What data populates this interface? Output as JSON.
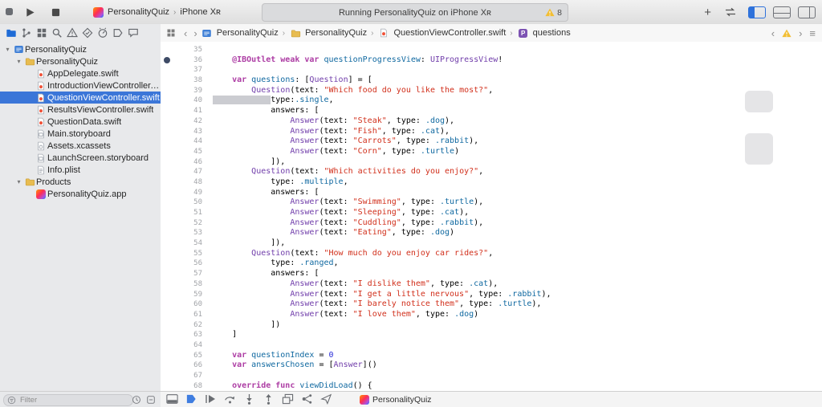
{
  "toolbar": {
    "scheme": "PersonalityQuiz",
    "device": "iPhone Xʀ",
    "status_text": "Running PersonalityQuiz on iPhone Xʀ",
    "warning_count": "8",
    "plus_label": "+"
  },
  "glyphs": {
    "back": "‹",
    "forward": "›",
    "crumb_sep": "›",
    "menu": "≡",
    "disclosure": "▾"
  },
  "navigator": {
    "tabs": [
      "project",
      "source-control",
      "symbol",
      "find",
      "issue",
      "test",
      "debug",
      "breakpoint",
      "report"
    ],
    "active": "project"
  },
  "jumpbar": {
    "crumbs": [
      {
        "label": "PersonalityQuiz",
        "icon": "project"
      },
      {
        "label": "PersonalityQuiz",
        "icon": "folder"
      },
      {
        "label": "QuestionViewController.swift",
        "icon": "swift"
      },
      {
        "label": "questions",
        "icon": "property"
      }
    ],
    "property_letter": "P"
  },
  "sidebar": {
    "items": [
      {
        "label": "PersonalityQuiz",
        "icon": "project",
        "level": 0,
        "disclosure": true
      },
      {
        "label": "PersonalityQuiz",
        "icon": "folder",
        "level": 1,
        "disclosure": true
      },
      {
        "label": "AppDelegate.swift",
        "icon": "swift",
        "level": 2
      },
      {
        "label": "IntroductionViewController.swift",
        "icon": "swift",
        "level": 2
      },
      {
        "label": "QuestionViewController.swift",
        "icon": "swift",
        "level": 2,
        "selected": true
      },
      {
        "label": "ResultsViewController.swift",
        "icon": "swift",
        "level": 2
      },
      {
        "label": "QuestionData.swift",
        "icon": "swift",
        "level": 2
      },
      {
        "label": "Main.storyboard",
        "icon": "storyboard",
        "level": 2
      },
      {
        "label": "Assets.xcassets",
        "icon": "assets",
        "level": 2
      },
      {
        "label": "LaunchScreen.storyboard",
        "icon": "storyboard",
        "level": 2
      },
      {
        "label": "Info.plist",
        "icon": "plist",
        "level": 2
      },
      {
        "label": "Products",
        "icon": "folder",
        "level": 1,
        "disclosure": true
      },
      {
        "label": "PersonalityQuiz.app",
        "icon": "app",
        "level": 2
      }
    ]
  },
  "editor": {
    "lines": [
      {
        "n": "35",
        "segs": []
      },
      {
        "n": "36",
        "well": true,
        "segs": [
          [
            "k",
            "    @IBOutlet weak var "
          ],
          [
            "d",
            "questionProgressView"
          ],
          [
            "p",
            ": "
          ],
          [
            "t",
            "UIProgressView"
          ],
          [
            "p",
            "!"
          ]
        ]
      },
      {
        "n": "37",
        "segs": []
      },
      {
        "n": "38",
        "segs": [
          [
            "k",
            "    var "
          ],
          [
            "d",
            "questions"
          ],
          [
            "p",
            ": ["
          ],
          [
            "t",
            "Question"
          ],
          [
            "p",
            "] = ["
          ]
        ]
      },
      {
        "n": "39",
        "segs": [
          [
            "p",
            "        "
          ],
          [
            "t",
            "Question"
          ],
          [
            "p",
            "(text: "
          ],
          [
            "s",
            "\"Which food do you like the most?\""
          ],
          [
            "p",
            ","
          ]
        ]
      },
      {
        "n": "40",
        "segs": [
          [
            "w",
            "            "
          ],
          [
            "p",
            "type:"
          ],
          [
            "e",
            ".single"
          ],
          [
            "p",
            ","
          ]
        ]
      },
      {
        "n": "41",
        "segs": [
          [
            "p",
            "            answers: ["
          ]
        ]
      },
      {
        "n": "42",
        "segs": [
          [
            "p",
            "                "
          ],
          [
            "t",
            "Answer"
          ],
          [
            "p",
            "(text: "
          ],
          [
            "s",
            "\"Steak\""
          ],
          [
            "p",
            ", type: "
          ],
          [
            "e",
            ".dog"
          ],
          [
            "p",
            "),"
          ]
        ]
      },
      {
        "n": "43",
        "segs": [
          [
            "p",
            "                "
          ],
          [
            "t",
            "Answer"
          ],
          [
            "p",
            "(text: "
          ],
          [
            "s",
            "\"Fish\""
          ],
          [
            "p",
            ", type: "
          ],
          [
            "e",
            ".cat"
          ],
          [
            "p",
            "),"
          ]
        ]
      },
      {
        "n": "44",
        "segs": [
          [
            "p",
            "                "
          ],
          [
            "t",
            "Answer"
          ],
          [
            "p",
            "(text: "
          ],
          [
            "s",
            "\"Carrots\""
          ],
          [
            "p",
            ", type: "
          ],
          [
            "e",
            ".rabbit"
          ],
          [
            "p",
            "),"
          ]
        ]
      },
      {
        "n": "45",
        "segs": [
          [
            "p",
            "                "
          ],
          [
            "t",
            "Answer"
          ],
          [
            "p",
            "(text: "
          ],
          [
            "s",
            "\"Corn\""
          ],
          [
            "p",
            ", type: "
          ],
          [
            "e",
            ".turtle"
          ],
          [
            "p",
            ")"
          ]
        ]
      },
      {
        "n": "46",
        "segs": [
          [
            "p",
            "            ]),"
          ]
        ]
      },
      {
        "n": "47",
        "segs": [
          [
            "p",
            "        "
          ],
          [
            "t",
            "Question"
          ],
          [
            "p",
            "(text: "
          ],
          [
            "s",
            "\"Which activities do you enjoy?\""
          ],
          [
            "p",
            ","
          ]
        ]
      },
      {
        "n": "48",
        "segs": [
          [
            "p",
            "            type: "
          ],
          [
            "e",
            ".multiple"
          ],
          [
            "p",
            ","
          ]
        ]
      },
      {
        "n": "49",
        "segs": [
          [
            "p",
            "            answers: ["
          ]
        ]
      },
      {
        "n": "50",
        "segs": [
          [
            "p",
            "                "
          ],
          [
            "t",
            "Answer"
          ],
          [
            "p",
            "(text: "
          ],
          [
            "s",
            "\"Swimming\""
          ],
          [
            "p",
            ", type: "
          ],
          [
            "e",
            ".turtle"
          ],
          [
            "p",
            "),"
          ]
        ]
      },
      {
        "n": "51",
        "segs": [
          [
            "p",
            "                "
          ],
          [
            "t",
            "Answer"
          ],
          [
            "p",
            "(text: "
          ],
          [
            "s",
            "\"Sleeping\""
          ],
          [
            "p",
            ", type: "
          ],
          [
            "e",
            ".cat"
          ],
          [
            "p",
            "),"
          ]
        ]
      },
      {
        "n": "52",
        "segs": [
          [
            "p",
            "                "
          ],
          [
            "t",
            "Answer"
          ],
          [
            "p",
            "(text: "
          ],
          [
            "s",
            "\"Cuddling\""
          ],
          [
            "p",
            ", type: "
          ],
          [
            "e",
            ".rabbit"
          ],
          [
            "p",
            "),"
          ]
        ]
      },
      {
        "n": "53",
        "segs": [
          [
            "p",
            "                "
          ],
          [
            "t",
            "Answer"
          ],
          [
            "p",
            "(text: "
          ],
          [
            "s",
            "\"Eating\""
          ],
          [
            "p",
            ", type: "
          ],
          [
            "e",
            ".dog"
          ],
          [
            "p",
            ")"
          ]
        ]
      },
      {
        "n": "54",
        "segs": [
          [
            "p",
            "            ]),"
          ]
        ]
      },
      {
        "n": "55",
        "segs": [
          [
            "p",
            "        "
          ],
          [
            "t",
            "Question"
          ],
          [
            "p",
            "(text: "
          ],
          [
            "s",
            "\"How much do you enjoy car rides?\""
          ],
          [
            "p",
            ","
          ]
        ]
      },
      {
        "n": "56",
        "segs": [
          [
            "p",
            "            type: "
          ],
          [
            "e",
            ".ranged"
          ],
          [
            "p",
            ","
          ]
        ]
      },
      {
        "n": "57",
        "segs": [
          [
            "p",
            "            answers: ["
          ]
        ]
      },
      {
        "n": "58",
        "segs": [
          [
            "p",
            "                "
          ],
          [
            "t",
            "Answer"
          ],
          [
            "p",
            "(text: "
          ],
          [
            "s",
            "\"I dislike them\""
          ],
          [
            "p",
            ", type: "
          ],
          [
            "e",
            ".cat"
          ],
          [
            "p",
            "),"
          ]
        ]
      },
      {
        "n": "59",
        "segs": [
          [
            "p",
            "                "
          ],
          [
            "t",
            "Answer"
          ],
          [
            "p",
            "(text: "
          ],
          [
            "s",
            "\"I get a little nervous\""
          ],
          [
            "p",
            ", type: "
          ],
          [
            "e",
            ".rabbit"
          ],
          [
            "p",
            "),"
          ]
        ]
      },
      {
        "n": "60",
        "segs": [
          [
            "p",
            "                "
          ],
          [
            "t",
            "Answer"
          ],
          [
            "p",
            "(text: "
          ],
          [
            "s",
            "\"I barely notice them\""
          ],
          [
            "p",
            ", type: "
          ],
          [
            "e",
            ".turtle"
          ],
          [
            "p",
            "),"
          ]
        ]
      },
      {
        "n": "61",
        "segs": [
          [
            "p",
            "                "
          ],
          [
            "t",
            "Answer"
          ],
          [
            "p",
            "(text: "
          ],
          [
            "s",
            "\"I love them\""
          ],
          [
            "p",
            ", type: "
          ],
          [
            "e",
            ".dog"
          ],
          [
            "p",
            ")"
          ]
        ]
      },
      {
        "n": "62",
        "segs": [
          [
            "p",
            "            ])"
          ]
        ]
      },
      {
        "n": "63",
        "segs": [
          [
            "p",
            "    ]"
          ]
        ]
      },
      {
        "n": "64",
        "segs": []
      },
      {
        "n": "65",
        "segs": [
          [
            "k",
            "    var "
          ],
          [
            "d",
            "questionIndex"
          ],
          [
            "p",
            " = "
          ],
          [
            "num",
            "0"
          ]
        ]
      },
      {
        "n": "66",
        "segs": [
          [
            "k",
            "    var "
          ],
          [
            "d",
            "answersChosen"
          ],
          [
            "p",
            " = ["
          ],
          [
            "t",
            "Answer"
          ],
          [
            "p",
            "]()"
          ]
        ]
      },
      {
        "n": "67",
        "segs": []
      },
      {
        "n": "68",
        "segs": [
          [
            "k",
            "    override func "
          ],
          [
            "d",
            "viewDidLoad"
          ],
          [
            "p",
            "() {"
          ]
        ]
      }
    ]
  },
  "filterbar": {
    "placeholder": "Filter"
  },
  "debugbar": {
    "icons": [
      "hide-debug-area",
      "breakpoints-toggle",
      "continue",
      "step-over",
      "step-into",
      "step-out",
      "view-hierarchy",
      "memory-graph",
      "simulate-location"
    ],
    "process": "PersonalityQuiz"
  }
}
